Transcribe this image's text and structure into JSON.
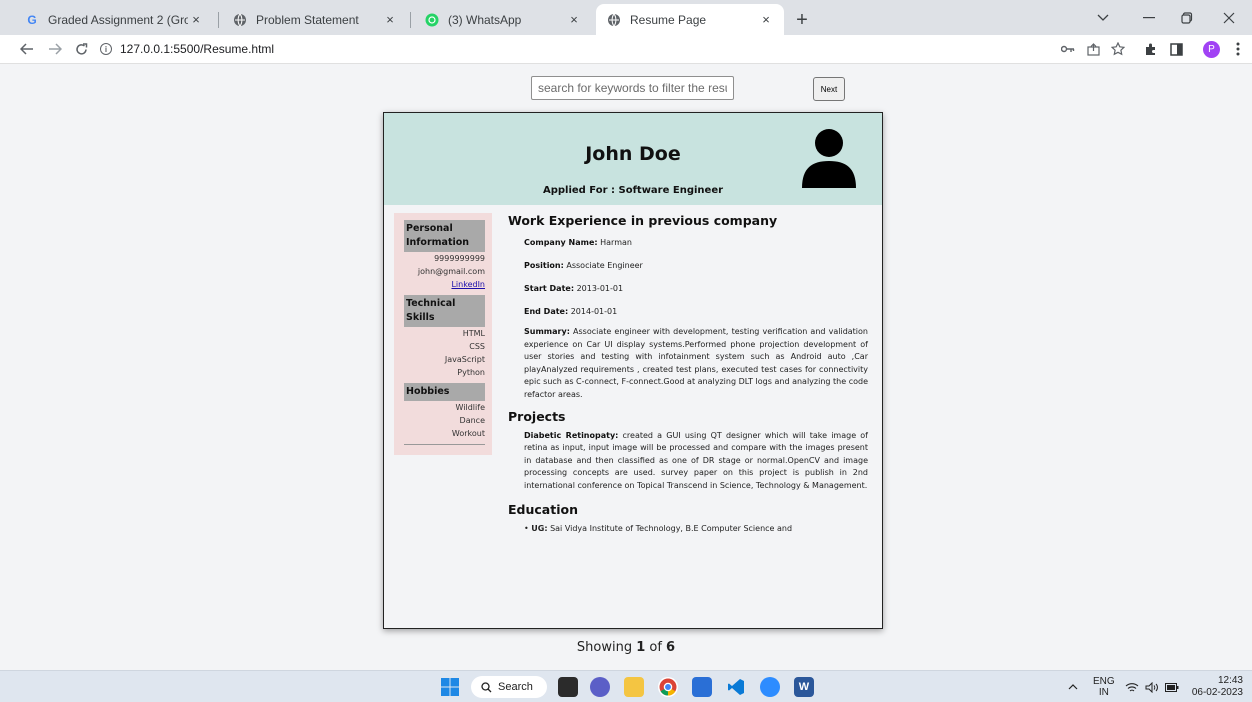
{
  "browser": {
    "tabs": [
      {
        "title": "Graded Assignment 2 (Group): Ja",
        "close": "×"
      },
      {
        "title": "Problem Statement",
        "close": "×"
      },
      {
        "title": "(3) WhatsApp",
        "close": "×"
      },
      {
        "title": "Resume Page",
        "close": "×"
      }
    ],
    "new_tab": "+",
    "url": "127.0.0.1:5500/Resume.html",
    "profile_initial": "P"
  },
  "page": {
    "search_placeholder": "search for keywords to filter the resu",
    "next_label": "Next",
    "showing": {
      "prefix": "Showing ",
      "current": "1",
      "middle": " of ",
      "total": "6"
    }
  },
  "resume": {
    "name": "John Doe",
    "applied_for": "Applied For : Software Engineer",
    "sidebar": {
      "personal_heading": "Personal Information",
      "phone": "9999999999",
      "email": "john@gmail.com",
      "linkedin": "LinkedIn",
      "skills_heading": "Technical Skills",
      "skills": [
        "HTML",
        "CSS",
        "JavaScript",
        "Python"
      ],
      "hobbies_heading": "Hobbies",
      "hobbies": [
        "Wildlife",
        "Dance",
        "Workout"
      ]
    },
    "work": {
      "heading": "Work Experience in previous company",
      "company_label": "Company Name:",
      "company": " Harman",
      "position_label": "Position:",
      "position": " Associate Engineer",
      "start_label": "Start Date:",
      "start": " 2013-01-01",
      "end_label": "End Date:",
      "end": " 2014-01-01",
      "summary_label": "Summary:",
      "summary": " Associate engineer with development, testing verification and validation experience on Car UI display systems.Performed phone projection development of user stories and testing with infotainment system such as Android auto ,Car playAnalyzed requirements , created test plans, executed test cases for connectivity epic such as C-connect, F-connect.Good at analyzing DLT logs and analyzing the code refactor areas."
    },
    "projects": {
      "heading": "Projects",
      "name": "Diabetic Retinopaty:",
      "description": " created a GUI using QT designer which will take image of retina as input, input image will be processed and compare with the images present in database and then classified as one of DR stage or normal.OpenCV and image processing concepts are used. survey paper on this project is publish in 2nd international conference on Topical Transcend in Science, Technology & Management."
    },
    "education": {
      "heading": "Education",
      "ug_label": "UG:",
      "ug": " Sai Vidya Institute of Technology, B.E Computer Science and"
    }
  },
  "taskbar": {
    "search_label": "Search",
    "lang_top": "ENG",
    "lang_bottom": "IN",
    "time": "12:43",
    "date": "06-02-2023"
  }
}
